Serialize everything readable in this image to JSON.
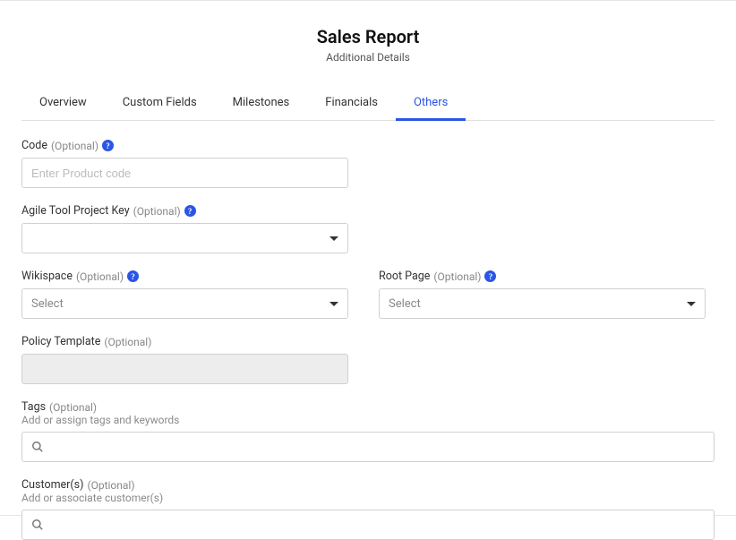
{
  "header": {
    "title": "Sales Report",
    "subtitle": "Additional Details"
  },
  "tabs": {
    "overview": "Overview",
    "customFields": "Custom Fields",
    "milestones": "Milestones",
    "financials": "Financials",
    "others": "Others"
  },
  "fields": {
    "code": {
      "label": "Code",
      "optional": "(Optional)",
      "placeholder": "Enter Product code"
    },
    "agileKey": {
      "label": "Agile Tool Project Key",
      "optional": "(Optional)"
    },
    "wikispace": {
      "label": "Wikispace",
      "optional": "(Optional)",
      "placeholder": "Select"
    },
    "rootPage": {
      "label": "Root Page",
      "optional": "(Optional)",
      "placeholder": "Select"
    },
    "policyTemplate": {
      "label": "Policy Template",
      "optional": "(Optional)"
    },
    "tags": {
      "label": "Tags",
      "optional": "(Optional)",
      "hint": "Add or assign tags and keywords"
    },
    "customers": {
      "label": "Customer(s)",
      "optional": "(Optional)",
      "hint": "Add or associate customer(s)"
    }
  },
  "icons": {
    "help": "?"
  }
}
